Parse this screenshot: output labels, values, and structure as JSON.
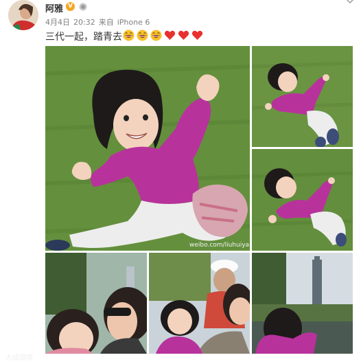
{
  "post": {
    "username": "阿雅",
    "date": "4月4日",
    "time": "20:32",
    "source_prefix": "来自",
    "source": "iPhone 6",
    "text": "三代一起，踏青去~",
    "emoticons": [
      "laugh-emoji",
      "laugh-emoji",
      "laugh-emoji",
      "heart-emoji",
      "heart-emoji",
      "heart-emoji"
    ]
  },
  "watermarks": {
    "main_photo": "weibo.com/liuhuiya",
    "bottom_left": "大成頭條"
  },
  "colors": {
    "verified_badge": "#f5a623",
    "heart": "#e8312f",
    "sweater_magenta": "#b8329c",
    "grass": "#5f8a3a"
  }
}
